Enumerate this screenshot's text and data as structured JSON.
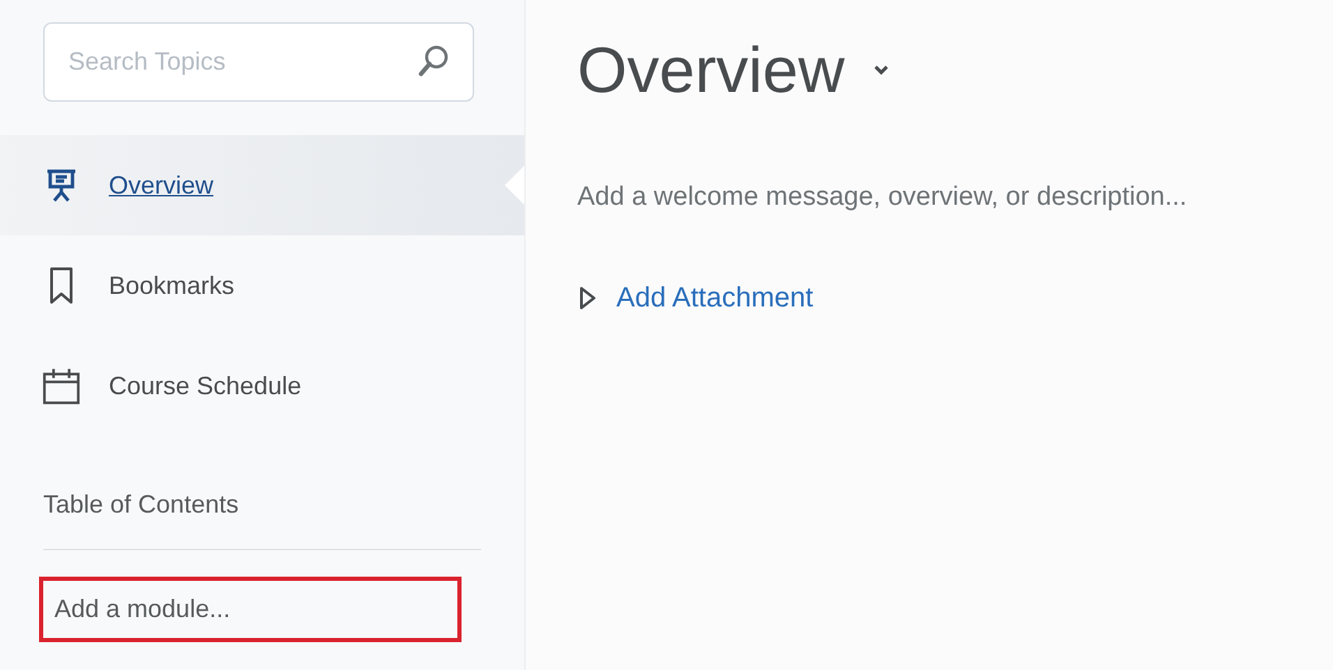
{
  "sidebar": {
    "search": {
      "placeholder": "Search Topics"
    },
    "items": [
      {
        "label": "Overview",
        "kind": "presentation",
        "selected": true
      },
      {
        "label": "Bookmarks",
        "kind": "bookmark",
        "selected": false
      },
      {
        "label": "Course Schedule",
        "kind": "calendar",
        "selected": false
      }
    ],
    "section_heading": "Table of Contents",
    "add_module": {
      "placeholder": "Add a module...",
      "highlighted": true
    }
  },
  "main": {
    "title": "Overview",
    "description_placeholder": "Add a welcome message, overview, or description...",
    "attachment_link": "Add Attachment",
    "attachment_expanded": false
  }
}
